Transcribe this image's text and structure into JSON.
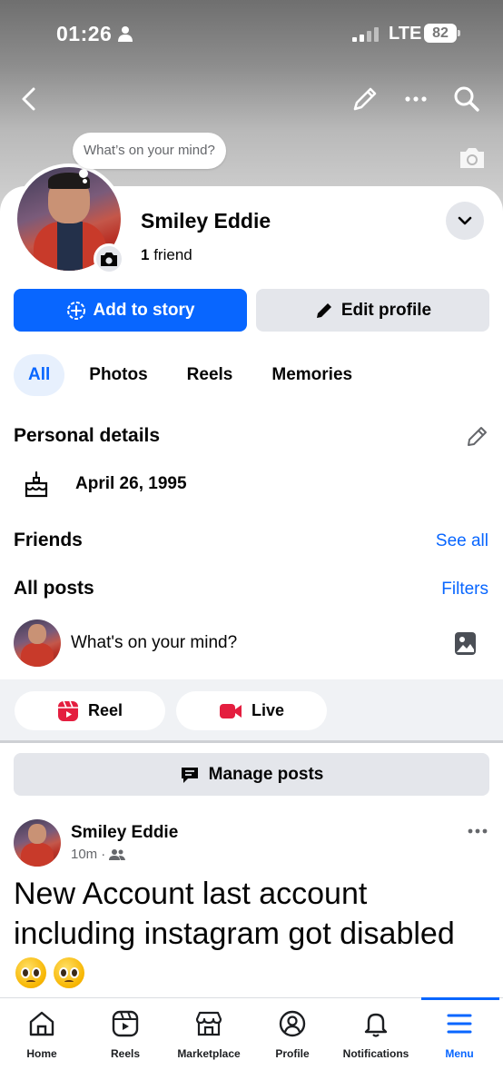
{
  "status_bar": {
    "time": "01:26",
    "network": "LTE",
    "battery": "82"
  },
  "composer_bubble": "What’s on your mind?",
  "profile": {
    "name": "Smiley Eddie",
    "friends_count": "1",
    "friends_label": "friend",
    "add_story_label": "Add to story",
    "edit_profile_label": "Edit profile"
  },
  "tabs": [
    "All",
    "Photos",
    "Reels",
    "Memories"
  ],
  "personal_details": {
    "title": "Personal details",
    "birthday": "April 26, 1995"
  },
  "friends_section": {
    "title": "Friends",
    "link": "See all"
  },
  "posts_section": {
    "title": "All posts",
    "link": "Filters"
  },
  "composer": {
    "placeholder": "What's on your mind?"
  },
  "quick_actions": {
    "reel": "Reel",
    "live": "Live"
  },
  "manage_posts": "Manage posts",
  "post": {
    "author": "Smiley Eddie",
    "time": "10m",
    "separator": "·",
    "text": "New Account last account including instagram got disabled"
  },
  "bottom_nav": [
    {
      "label": "Home",
      "icon": "home-icon"
    },
    {
      "label": "Reels",
      "icon": "reels-icon"
    },
    {
      "label": "Marketplace",
      "icon": "marketplace-icon"
    },
    {
      "label": "Profile",
      "icon": "profile-icon"
    },
    {
      "label": "Notifications",
      "icon": "bell-icon"
    },
    {
      "label": "Menu",
      "icon": "menu-icon"
    }
  ],
  "colors": {
    "accent": "#0866ff",
    "secondary_button": "#e4e6eb",
    "band": "#f0f2f5",
    "reel_icon": "#e41e3f",
    "live_icon": "#e41e3f"
  }
}
